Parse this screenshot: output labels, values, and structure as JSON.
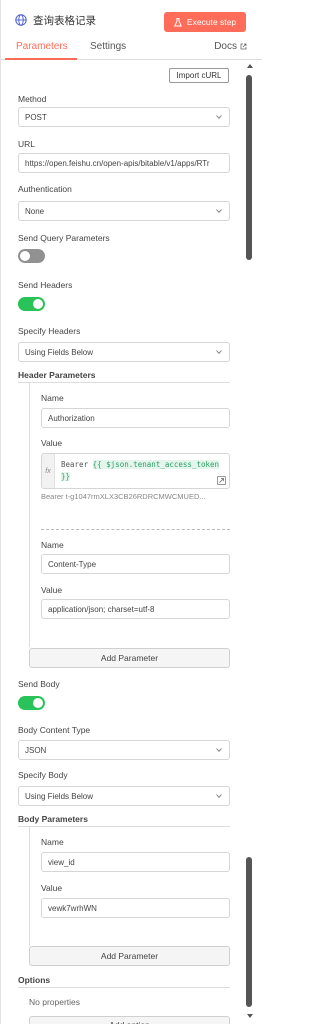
{
  "header": {
    "title": "查询表格记录",
    "execute_label": "Execute step"
  },
  "tabs": [
    {
      "label": "Parameters"
    },
    {
      "label": "Settings"
    },
    {
      "label": "Docs"
    }
  ],
  "import_curl_label": "Import cURL",
  "method": {
    "label": "Method",
    "value": "POST"
  },
  "url": {
    "label": "URL",
    "value": "https://open.feishu.cn/open-apis/bitable/v1/apps/RTr"
  },
  "authentication": {
    "label": "Authentication",
    "value": "None"
  },
  "send_query": {
    "label": "Send Query Parameters",
    "enabled": false
  },
  "send_headers": {
    "label": "Send Headers",
    "enabled": true
  },
  "specify_headers": {
    "label": "Specify Headers",
    "value": "Using Fields Below"
  },
  "header_parameters": {
    "title": "Header Parameters",
    "params": [
      {
        "name_label": "Name",
        "name": "Authorization",
        "value_label": "Value",
        "value_prefix": "Bearer ",
        "value_expression": "{{ $json.tenant_access_token }}",
        "preview": "Bearer t-g1047rmXLX3CB26RDRCMWCMUED..."
      },
      {
        "name_label": "Name",
        "name": "Content-Type",
        "value_label": "Value",
        "value": "application/json; charset=utf-8"
      }
    ],
    "add_label": "Add Parameter"
  },
  "send_body": {
    "label": "Send Body",
    "enabled": true
  },
  "body_content_type": {
    "label": "Body Content Type",
    "value": "JSON"
  },
  "specify_body": {
    "label": "Specify Body",
    "value": "Using Fields Below"
  },
  "body_parameters": {
    "title": "Body Parameters",
    "params": [
      {
        "name_label": "Name",
        "name": "view_id",
        "value_label": "Value",
        "value": "vewk7wrhWN"
      }
    ],
    "add_label": "Add Parameter"
  },
  "options": {
    "title": "Options",
    "empty_text": "No properties",
    "add_label": "Add option"
  },
  "colors": {
    "accent": "#ff6d5a",
    "toggle_on": "#29c35a",
    "toggle_off": "#919191",
    "expression": "#2e9d66"
  },
  "icons": {
    "header": "globe-icon",
    "execute": "flask-icon",
    "docs": "external-link-icon",
    "dropdown": "chevron-down-icon",
    "expression": "fx-icon",
    "expand": "expand-icon"
  }
}
